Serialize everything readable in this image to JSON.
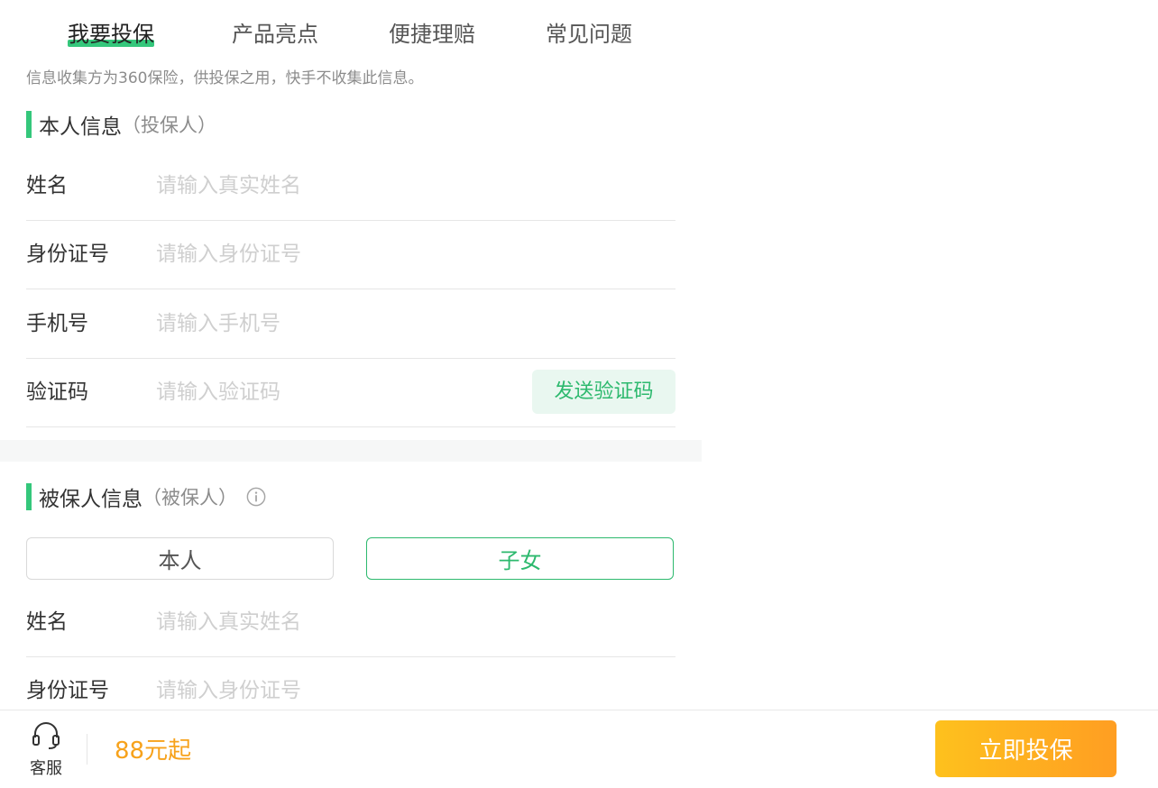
{
  "tabs": [
    {
      "label": "我要投保",
      "active": true
    },
    {
      "label": "产品亮点",
      "active": false
    },
    {
      "label": "便捷理赔",
      "active": false
    },
    {
      "label": "常见问题",
      "active": false
    }
  ],
  "notice": "信息收集方为360保险，供投保之用，快手不收集此信息。",
  "applicant": {
    "title": "本人信息",
    "subtitle": "（投保人）",
    "fields": [
      {
        "label": "姓名",
        "placeholder": "请输入真实姓名",
        "value": ""
      },
      {
        "label": "身份证号",
        "placeholder": "请输入身份证号",
        "value": ""
      },
      {
        "label": "手机号",
        "placeholder": "请输入手机号",
        "value": ""
      },
      {
        "label": "验证码",
        "placeholder": "请输入验证码",
        "value": ""
      }
    ],
    "send_code_label": "发送验证码"
  },
  "insured": {
    "title": "被保人信息",
    "subtitle": "（被保人）",
    "info_icon": "info-circle-icon",
    "choices": [
      {
        "label": "本人",
        "selected": false
      },
      {
        "label": "子女",
        "selected": true
      }
    ],
    "fields": [
      {
        "label": "姓名",
        "placeholder": "请输入真实姓名",
        "value": ""
      },
      {
        "label": "身份证号",
        "placeholder": "请输入身份证号",
        "value": ""
      }
    ]
  },
  "footer": {
    "service_icon": "headset-icon",
    "service_label": "客服",
    "price_label": "88元起",
    "buy_label": "立即投保"
  },
  "colors": {
    "accent_green": "#34c77b",
    "price_orange": "#f7a21b",
    "button_gradient_start": "#fec11d",
    "button_gradient_end": "#ff9e22"
  }
}
